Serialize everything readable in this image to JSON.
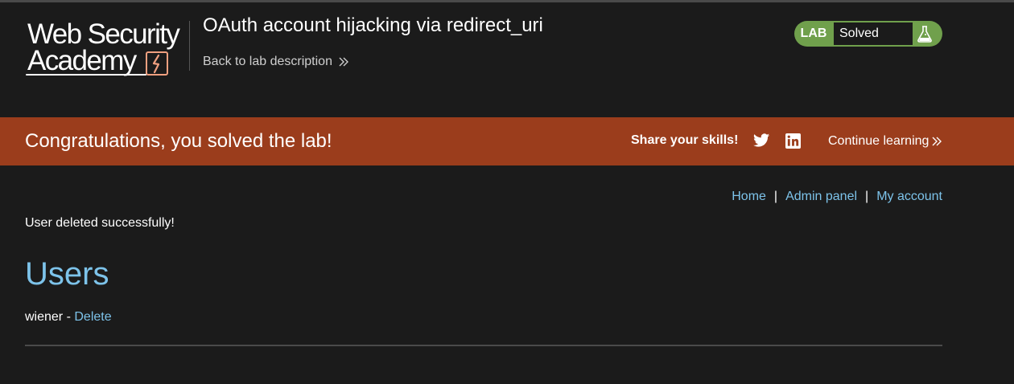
{
  "header": {
    "logo": {
      "line1": "Web Security",
      "line2": "Academy"
    },
    "lab_title": "OAuth account hijacking via redirect_uri",
    "back_link": "Back to lab description",
    "badge": {
      "label": "LAB",
      "status": "Solved",
      "icon": "flask-icon"
    }
  },
  "banner": {
    "message": "Congratulations, you solved the lab!",
    "share_label": "Share your skills!",
    "share_icons": [
      "twitter-icon",
      "linkedin-icon"
    ],
    "continue_label": "Continue learning"
  },
  "nav": {
    "home": "Home",
    "separator": "|",
    "admin_panel": "Admin panel",
    "my_account": "My account"
  },
  "main": {
    "notice": "User deleted successfully!",
    "heading": "Users",
    "users": [
      {
        "name": "wiener",
        "dash": " - ",
        "action": "Delete"
      }
    ]
  },
  "colors": {
    "background": "#1b1b1b",
    "banner": "#9b3d1c",
    "badge_green": "#70a04c",
    "link_blue": "#7dc3ea",
    "logo_accent": "#f0a080"
  }
}
